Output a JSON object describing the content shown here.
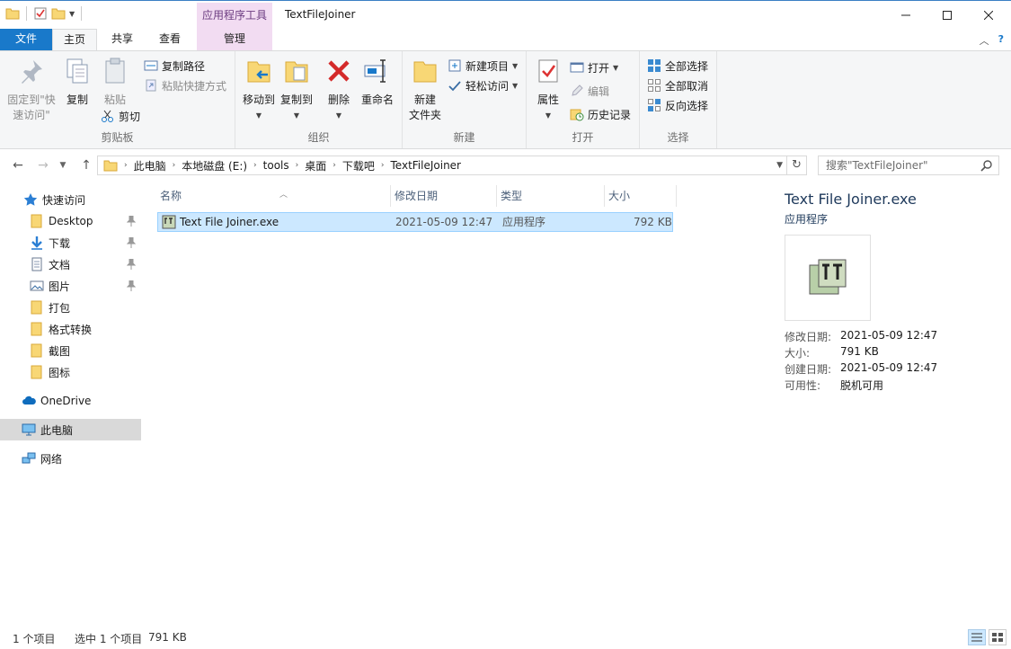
{
  "window": {
    "context_tab_group": "应用程序工具",
    "title": "TextFileJoiner"
  },
  "tabs": {
    "file": "文件",
    "home": "主页",
    "share": "共享",
    "view": "查看",
    "manage": "管理"
  },
  "ribbon": {
    "clipboard": {
      "label": "剪贴板",
      "pin_quick_access": [
        "固定到\"快",
        "速访问\""
      ],
      "copy": "复制",
      "paste": "粘贴",
      "copy_path": "复制路径",
      "paste_shortcut": "粘贴快捷方式",
      "cut": "剪切"
    },
    "organize": {
      "label": "组织",
      "move_to": "移动到",
      "copy_to": "复制到",
      "delete": "删除",
      "rename": "重命名"
    },
    "new": {
      "label": "新建",
      "new_folder": [
        "新建",
        "文件夹"
      ],
      "new_item": "新建项目",
      "easy_access": "轻松访问"
    },
    "open": {
      "label": "打开",
      "properties": "属性",
      "open": "打开",
      "edit": "编辑",
      "history": "历史记录"
    },
    "select": {
      "label": "选择",
      "select_all": "全部选择",
      "select_none": "全部取消",
      "invert": "反向选择"
    }
  },
  "address": {
    "crumbs": [
      "此电脑",
      "本地磁盘 (E:)",
      "tools",
      "桌面",
      "下载吧",
      "TextFileJoiner"
    ],
    "search_placeholder": "搜索\"TextFileJoiner\""
  },
  "nav": {
    "quick_access": "快速访问",
    "items": [
      "Desktop",
      "下载",
      "文档",
      "图片",
      "打包",
      "格式转换",
      "截图",
      "图标"
    ],
    "onedrive": "OneDrive",
    "this_pc": "此电脑",
    "network": "网络"
  },
  "files": {
    "columns": [
      "名称",
      "修改日期",
      "类型",
      "大小"
    ],
    "rows": [
      {
        "name": "Text File Joiner.exe",
        "date": "2021-05-09 12:47",
        "type": "应用程序",
        "size": "792 KB"
      }
    ]
  },
  "details": {
    "name": "Text File Joiner.exe",
    "type": "应用程序",
    "props": [
      {
        "k": "修改日期:",
        "v": "2021-05-09 12:47"
      },
      {
        "k": "大小:",
        "v": "791 KB"
      },
      {
        "k": "创建日期:",
        "v": "2021-05-09 12:47"
      },
      {
        "k": "可用性:",
        "v": "脱机可用"
      }
    ]
  },
  "status": {
    "count": "1 个项目",
    "selected": "选中 1 个项目",
    "size": "791 KB"
  },
  "colors": {
    "file_tab": "#1979ca",
    "manage_tab": "#f2dcf2",
    "selection": "#cce8ff"
  }
}
